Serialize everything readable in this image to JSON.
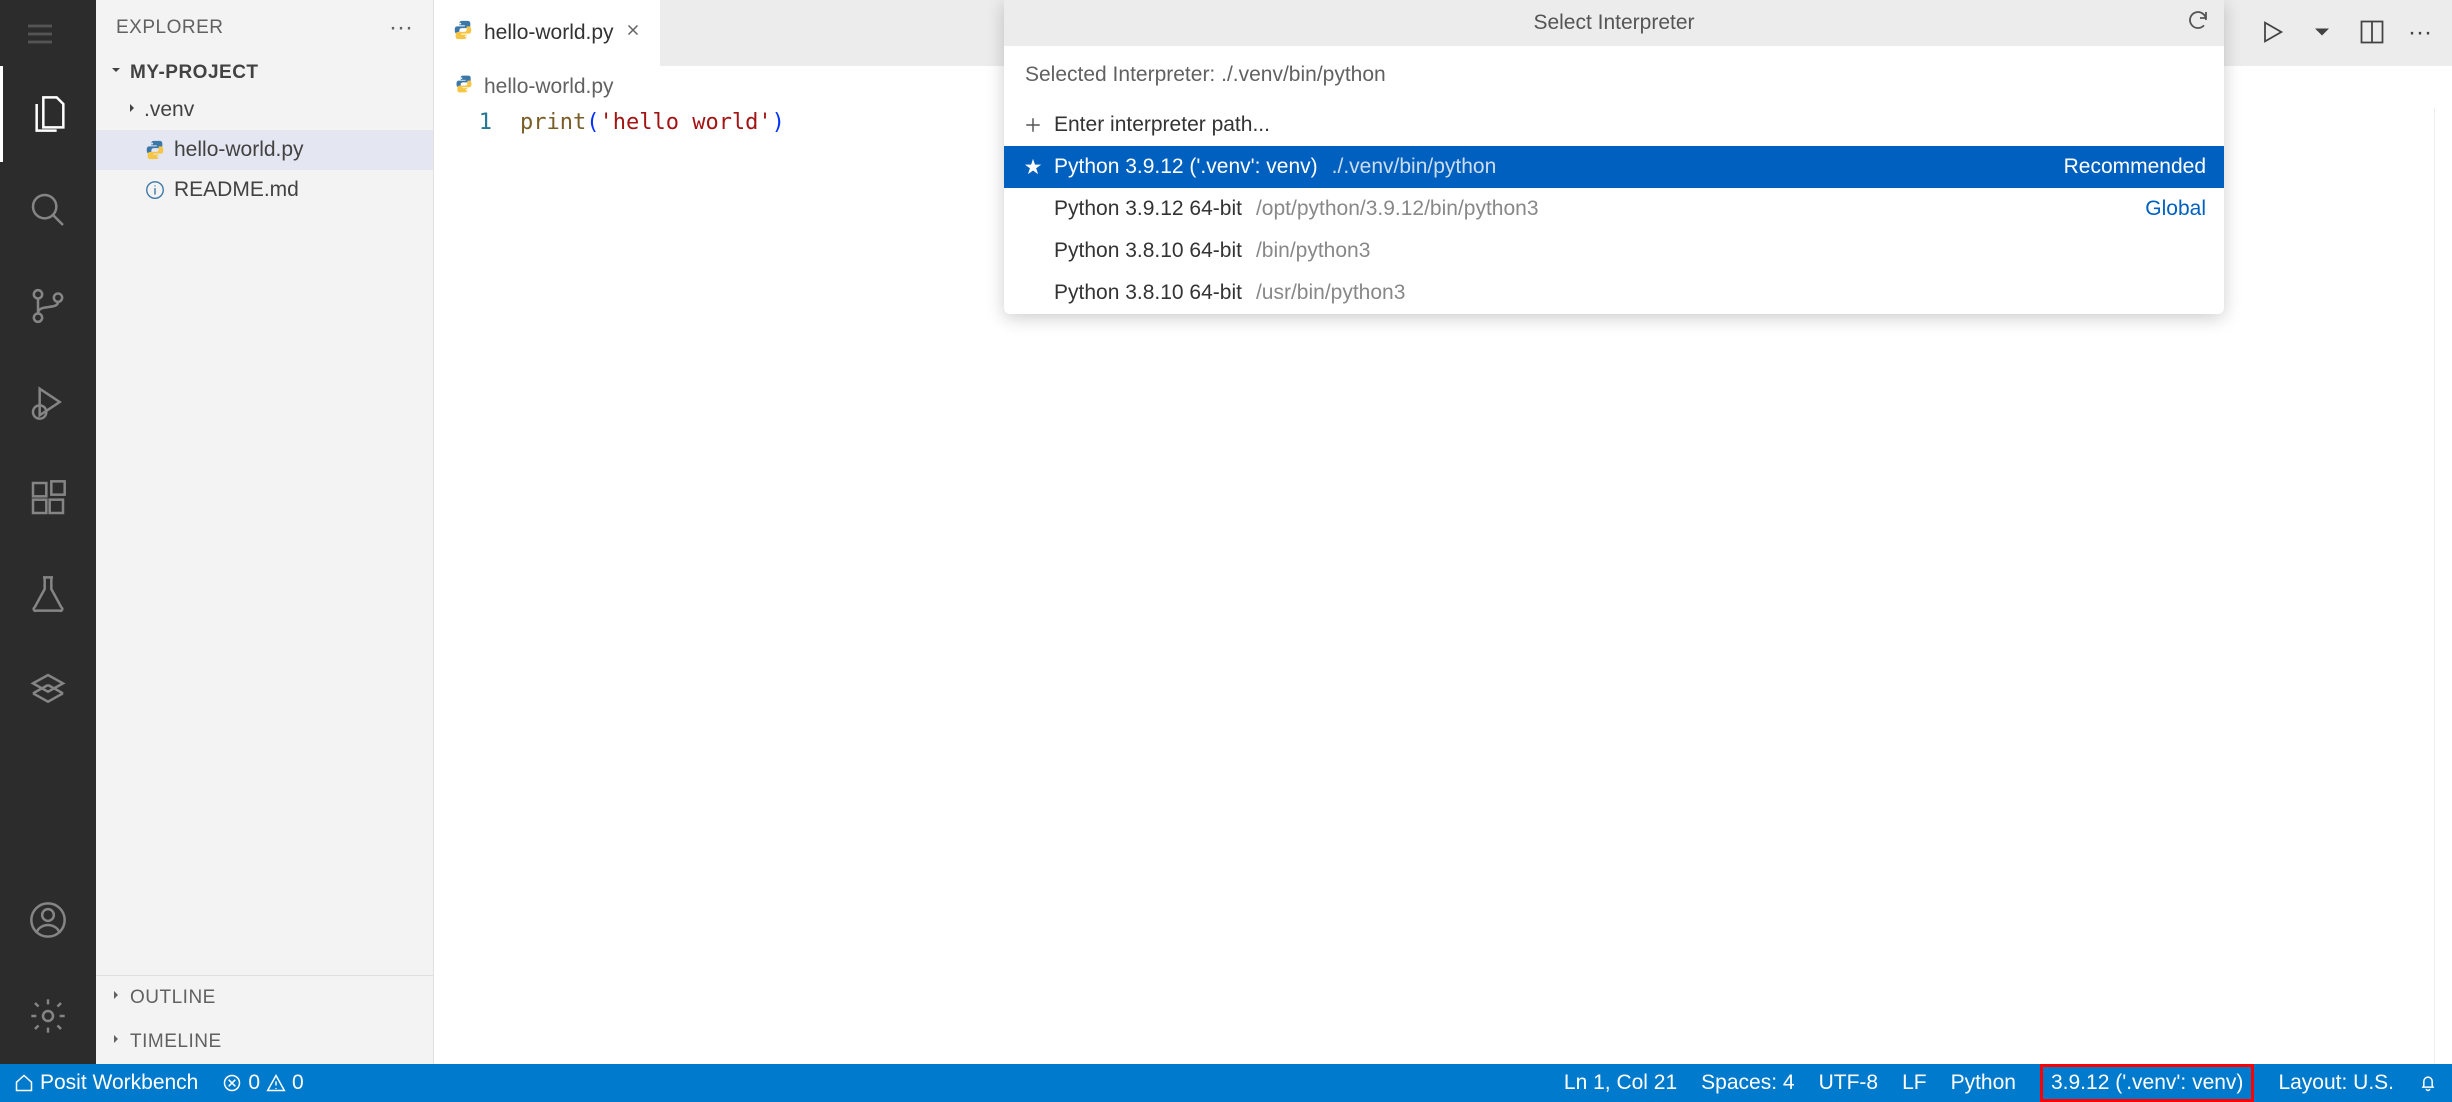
{
  "sidebar": {
    "title": "EXPLORER",
    "project": "MY-PROJECT",
    "items": [
      {
        "label": ".venv",
        "type": "folder"
      },
      {
        "label": "hello-world.py",
        "type": "python"
      },
      {
        "label": "README.md",
        "type": "info"
      }
    ],
    "outline": "OUTLINE",
    "timeline": "TIMELINE"
  },
  "tab": {
    "filename": "hello-world.py"
  },
  "breadcrumb": {
    "filename": "hello-world.py"
  },
  "editor": {
    "line_number": "1",
    "fn": "print",
    "open": "(",
    "str": "'hello world'",
    "close": ")"
  },
  "dropdown": {
    "title": "Select Interpreter",
    "input_value": "Selected Interpreter: ./.venv/bin/python",
    "enter_path": "Enter interpreter path...",
    "items": [
      {
        "label": "Python 3.9.12 ('.venv': venv)",
        "path": "./.venv/bin/python",
        "tag": "Recommended",
        "star": true
      },
      {
        "label": "Python 3.9.12 64-bit",
        "path": "/opt/python/3.9.12/bin/python3",
        "tag": "Global"
      },
      {
        "label": "Python 3.8.10 64-bit",
        "path": "/bin/python3",
        "tag": ""
      },
      {
        "label": "Python 3.8.10 64-bit",
        "path": "/usr/bin/python3",
        "tag": ""
      }
    ]
  },
  "status": {
    "workbench": "Posit Workbench",
    "errors": "0",
    "warnings": "0",
    "position": "Ln 1, Col 21",
    "spaces": "Spaces: 4",
    "encoding": "UTF-8",
    "eol": "LF",
    "language": "Python",
    "interpreter": "3.9.12 ('.venv': venv)",
    "layout": "Layout: U.S."
  }
}
